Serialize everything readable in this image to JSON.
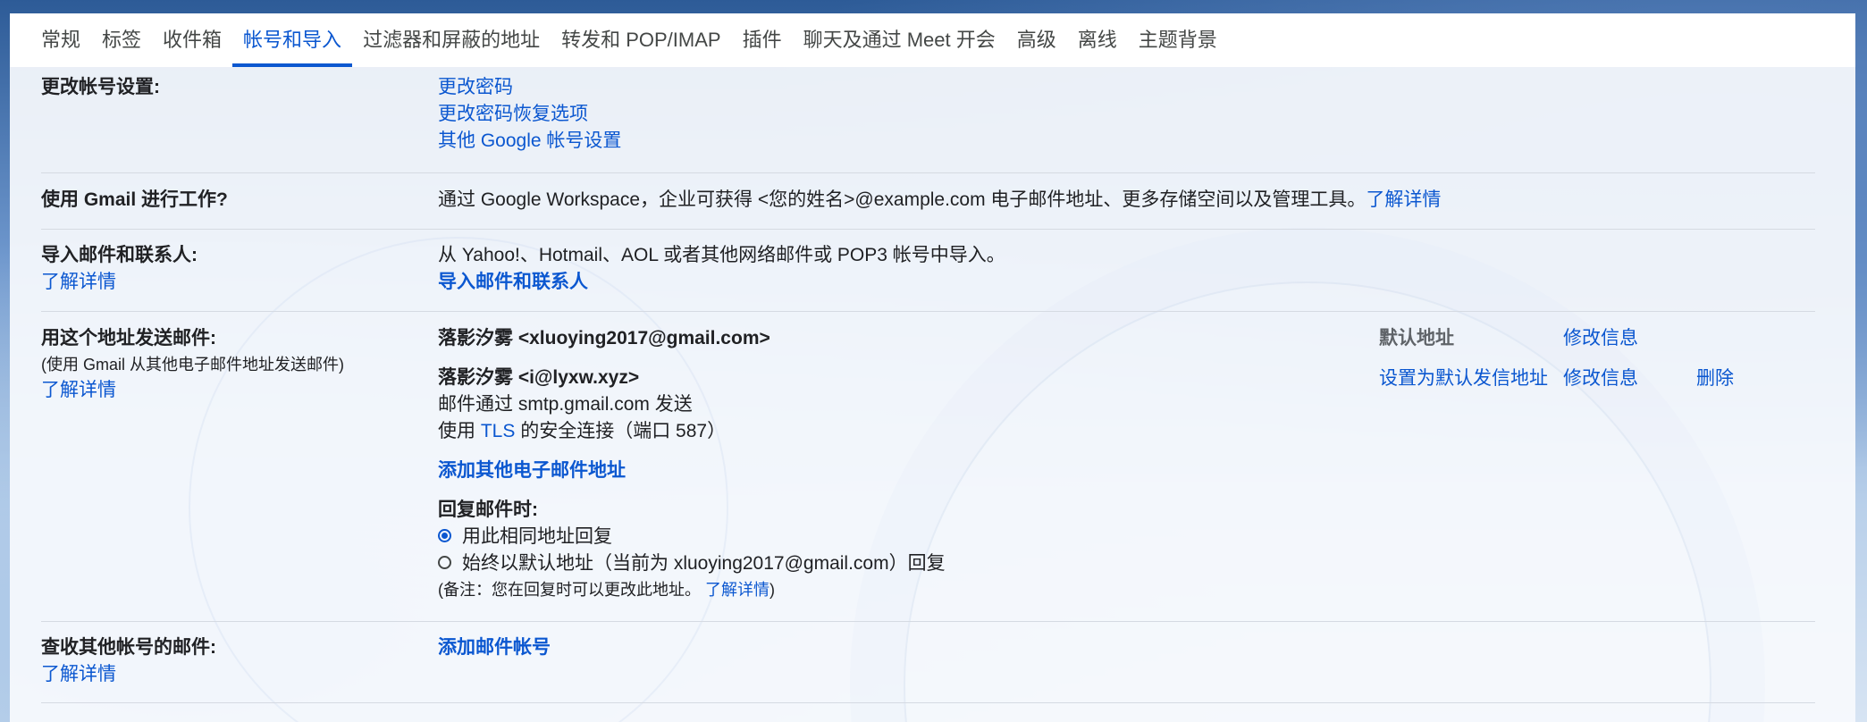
{
  "tabs": [
    {
      "label": "常规",
      "active": false
    },
    {
      "label": "标签",
      "active": false
    },
    {
      "label": "收件箱",
      "active": false
    },
    {
      "label": "帐号和导入",
      "active": true
    },
    {
      "label": "过滤器和屏蔽的地址",
      "active": false
    },
    {
      "label": "转发和 POP/IMAP",
      "active": false
    },
    {
      "label": "插件",
      "active": false
    },
    {
      "label": "聊天及通过 Meet 开会",
      "active": false
    },
    {
      "label": "高级",
      "active": false
    },
    {
      "label": "离线",
      "active": false
    },
    {
      "label": "主题背景",
      "active": false
    }
  ],
  "change_account": {
    "label": "更改帐号设置:",
    "links": [
      "更改密码",
      "更改密码恢复选项",
      "其他 Google 帐号设置"
    ]
  },
  "work": {
    "label": "使用 Gmail 进行工作?",
    "text": "通过 Google Workspace，企业可获得 <您的姓名>@example.com 电子邮件地址、更多存储空间以及管理工具。",
    "link": "了解详情"
  },
  "import": {
    "label": "导入邮件和联系人:",
    "learn_more": "了解详情",
    "text": "从 Yahoo!、Hotmail、AOL 或者其他网络邮件或 POP3 帐号中导入。",
    "action": "导入邮件和联系人"
  },
  "send_as": {
    "label": "用这个地址发送邮件:",
    "sublabel": "(使用 Gmail 从其他电子邮件地址发送邮件)",
    "learn_more": "了解详情",
    "addresses": [
      {
        "name": "落影汐雾 <xluoying2017@gmail.com>",
        "status": "默认地址",
        "edit": "修改信息"
      },
      {
        "name": "落影汐雾 <i@lyxw.xyz>",
        "via": "邮件通过 smtp.gmail.com 发送",
        "tls_prefix": "使用",
        "tls": "TLS",
        "tls_suffix": "的安全连接（端口 587）",
        "make_default": "设置为默认发信地址",
        "edit": "修改信息",
        "delete": "删除"
      }
    ],
    "add_address": "添加其他电子邮件地址",
    "reply_label": "回复邮件时:",
    "reply_options": [
      {
        "label": "用此相同地址回复",
        "checked": true
      },
      {
        "label": "始终以默认地址（当前为 xluoying2017@gmail.com）回复",
        "checked": false
      }
    ],
    "note_prefix": "(备注：您在回复时可以更改此地址。",
    "note_link": "了解详情",
    "note_suffix": ")"
  },
  "check_mail": {
    "label": "查收其他帐号的邮件:",
    "learn_more": "了解详情",
    "action": "添加邮件帐号"
  }
}
